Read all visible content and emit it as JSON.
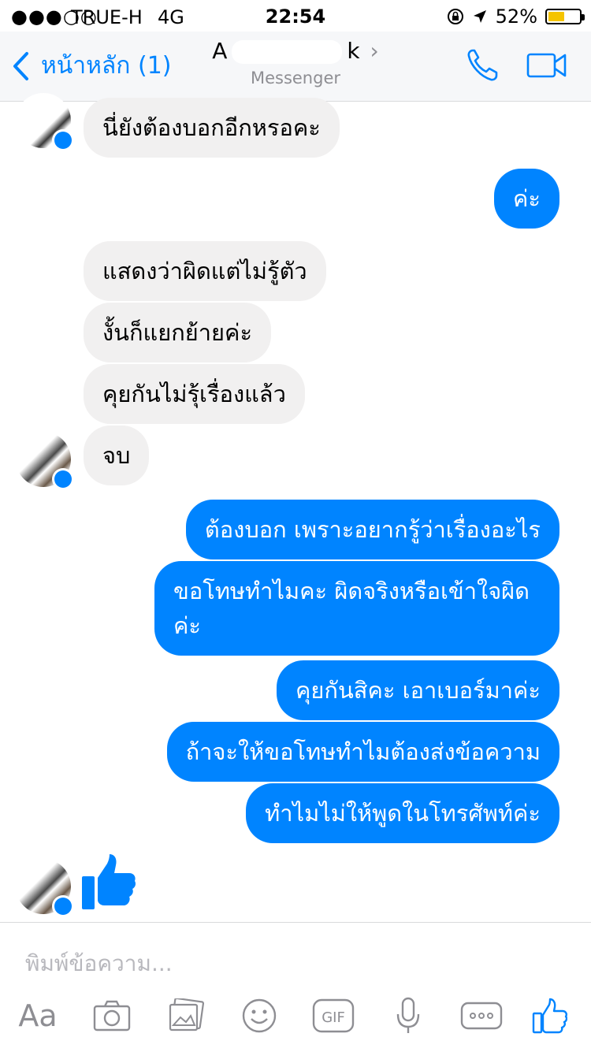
{
  "status_bar": {
    "signal": "●●●○○",
    "carrier": "TRUE-H",
    "network": "4G",
    "time": "22:54",
    "battery_percent": "52%",
    "battery_level": 0.52
  },
  "header": {
    "back_label": "หน้าหลัก (1)",
    "contact_name_start": "A",
    "contact_name_end": "k",
    "subtitle": "Messenger",
    "icons": [
      "chevron-left-icon",
      "phone-icon",
      "video-camera-icon"
    ]
  },
  "messages": [
    {
      "from": "them",
      "text": "นี่ยังต้องบอกอีกหรอคะ"
    },
    {
      "from": "me",
      "text": "ค่ะ"
    },
    {
      "from": "them",
      "text": "แสดงว่าผิดแต่ไม่รู้ตัว"
    },
    {
      "from": "them",
      "text": "งั้นก็แยกย้ายค่ะ"
    },
    {
      "from": "them",
      "text": "คุยกันไม่รุ้เรื่องแล้ว"
    },
    {
      "from": "them",
      "text": "จบ"
    },
    {
      "from": "me",
      "text": "ต้องบอก เพราะอยากรู้ว่าเรื่องอะไร"
    },
    {
      "from": "me",
      "text": "ขอโทษทำไมคะ ผิดจริงหรือเข้าใจผิดค่ะ"
    },
    {
      "from": "me",
      "text": "คุยกันสิคะ เอาเบอร์มาค่ะ"
    },
    {
      "from": "me",
      "text": "ถ้าจะให้ขอโทษทำไมต้องส่งข้อความ"
    },
    {
      "from": "me",
      "text": "ทำไมไม่ให้พูดในโทรศัพท์ค่ะ"
    }
  ],
  "composer": {
    "placeholder": "พิมพ์ข้อความ...",
    "aa_label": "Aa",
    "gif_label": "GIF",
    "tools": [
      "text-format-icon",
      "camera-icon",
      "photo-icon",
      "emoji-icon",
      "gif-icon",
      "microphone-icon",
      "more-icon",
      "like-icon"
    ]
  },
  "colors": {
    "accent": "#0084ff",
    "incoming_bubble": "#f1f0f0",
    "header_bg": "#f6f7f9",
    "tool_gray": "#8e8e93"
  }
}
